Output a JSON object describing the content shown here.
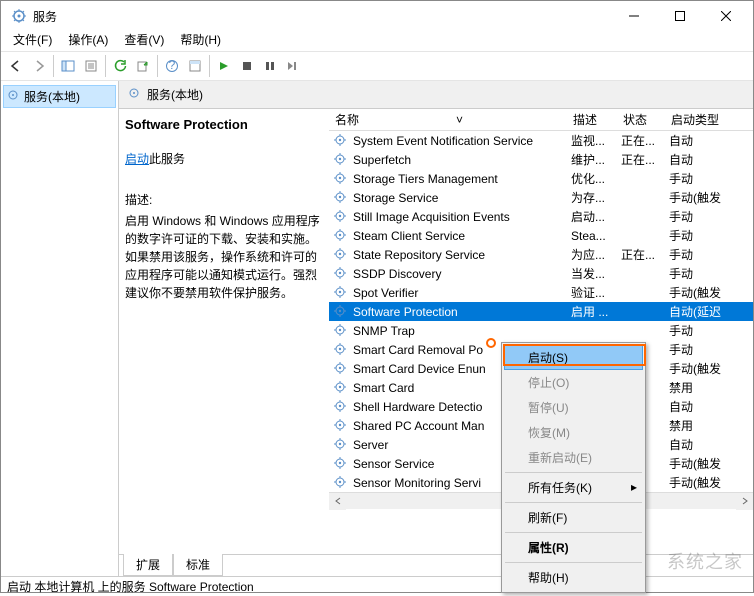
{
  "window": {
    "title": "服务",
    "menu": [
      "文件(F)",
      "操作(A)",
      "查看(V)",
      "帮助(H)"
    ]
  },
  "left_tree": {
    "node": "服务(本地)"
  },
  "header": {
    "title": "服务(本地)"
  },
  "detail": {
    "title": "Software Protection",
    "start_link": "启动",
    "start_suffix": "此服务",
    "desc_label": "描述:",
    "desc_text": "启用 Windows 和 Windows 应用程序的数字许可证的下载、安装和实施。如果禁用该服务，操作系统和许可的应用程序可能以通知模式运行。强烈建议你不要禁用软件保护服务。"
  },
  "columns": {
    "name": "名称",
    "desc": "描述",
    "status": "状态",
    "type": "启动类型"
  },
  "services": [
    {
      "name": "System Event Notification Service",
      "desc": "监视...",
      "status": "正在...",
      "type": "自动"
    },
    {
      "name": "Superfetch",
      "desc": "维护...",
      "status": "正在...",
      "type": "自动"
    },
    {
      "name": "Storage Tiers Management",
      "desc": "优化...",
      "status": "",
      "type": "手动"
    },
    {
      "name": "Storage Service",
      "desc": "为存...",
      "status": "",
      "type": "手动(触发"
    },
    {
      "name": "Still Image Acquisition Events",
      "desc": "启动...",
      "status": "",
      "type": "手动"
    },
    {
      "name": "Steam Client Service",
      "desc": "Stea...",
      "status": "",
      "type": "手动"
    },
    {
      "name": "State Repository Service",
      "desc": "为应...",
      "status": "正在...",
      "type": "手动"
    },
    {
      "name": "SSDP Discovery",
      "desc": "当发...",
      "status": "",
      "type": "手动"
    },
    {
      "name": "Spot Verifier",
      "desc": "验证...",
      "status": "",
      "type": "手动(触发"
    },
    {
      "name": "Software Protection",
      "desc": "启用 ...",
      "status": "",
      "type": "自动(延迟",
      "selected": true
    },
    {
      "name": "SNMP Trap",
      "desc": "",
      "status": "",
      "type": "手动"
    },
    {
      "name": "Smart Card Removal Po",
      "desc": "",
      "status": "",
      "type": "手动"
    },
    {
      "name": "Smart Card Device Enun",
      "desc": "",
      "status": "",
      "type": "手动(触发"
    },
    {
      "name": "Smart Card",
      "desc": "",
      "status": "",
      "type": "禁用"
    },
    {
      "name": "Shell Hardware Detectio",
      "desc": "",
      "status": "",
      "type": "自动"
    },
    {
      "name": "Shared PC Account Man",
      "desc": "",
      "status": "",
      "type": "禁用"
    },
    {
      "name": "Server",
      "desc": "",
      "status": "",
      "type": "自动"
    },
    {
      "name": "Sensor Service",
      "desc": "",
      "status": "",
      "type": "手动(触发"
    },
    {
      "name": "Sensor Monitoring Servi",
      "desc": "",
      "status": "",
      "type": "手动(触发"
    }
  ],
  "context_menu": [
    {
      "label": "启动(S)",
      "highlighted": true
    },
    {
      "label": "停止(O)",
      "disabled": true
    },
    {
      "label": "暂停(U)",
      "disabled": true
    },
    {
      "label": "恢复(M)",
      "disabled": true
    },
    {
      "label": "重新启动(E)",
      "disabled": true
    },
    {
      "sep": true
    },
    {
      "label": "所有任务(K)",
      "submenu": true
    },
    {
      "sep": true
    },
    {
      "label": "刷新(F)"
    },
    {
      "sep": true
    },
    {
      "label": "属性(R)",
      "bold": true
    },
    {
      "sep": true
    },
    {
      "label": "帮助(H)"
    }
  ],
  "tabs": [
    "扩展",
    "标准"
  ],
  "statusbar": "启动 本地计算机 上的服务 Software Protection",
  "watermark": "系统之家"
}
